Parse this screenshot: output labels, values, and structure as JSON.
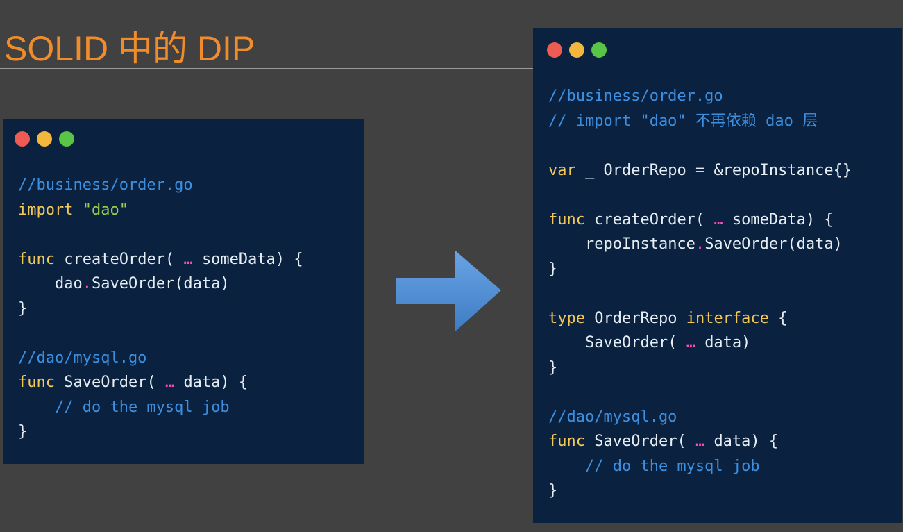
{
  "title": "SOLID 中的 DIP",
  "colors": {
    "background": "#414141",
    "title": "#f08c2c",
    "code_bg": "#0a2240",
    "comment": "#3d8fe0",
    "keyword": "#f4c857",
    "string": "#97cf4a",
    "operator": "#ff4dc0",
    "arrow": "#4a8ad0"
  },
  "left_code": {
    "l1": {
      "comment": "//business/order.go"
    },
    "l2": {
      "kw": "import",
      "str": "\"dao\""
    },
    "l4": {
      "kw": "func",
      "name": "createOrder(",
      "ellipsis": "…",
      "rest": "someData) {"
    },
    "l5": {
      "obj": "dao",
      "dot": ".",
      "call": "SaveOrder(data)"
    },
    "l6": {
      "brace": "}"
    },
    "l8": {
      "comment": "//dao/mysql.go"
    },
    "l9": {
      "kw": "func",
      "name": "SaveOrder(",
      "ellipsis": "…",
      "rest": "data) {"
    },
    "l10": {
      "comment": "// do the mysql job"
    },
    "l11": {
      "brace": "}"
    }
  },
  "right_code": {
    "l1": {
      "comment": "//business/order.go"
    },
    "l2": {
      "comment": "// import \"dao\" 不再依赖 dao 层"
    },
    "l4": {
      "kw": "var",
      "rest": "_ OrderRepo = &repoInstance{}"
    },
    "l6": {
      "kw": "func",
      "name": "createOrder(",
      "ellipsis": "…",
      "rest": "someData) {"
    },
    "l7": {
      "obj": "repoInstance",
      "dot": ".",
      "call": "SaveOrder(data)"
    },
    "l8": {
      "brace": "}"
    },
    "l10": {
      "kw": "type",
      "name": "OrderRepo",
      "kw2": "interface",
      "rest": "{"
    },
    "l11": {
      "name": "SaveOrder(",
      "ellipsis": "…",
      "rest": "data)"
    },
    "l12": {
      "brace": "}"
    },
    "l14": {
      "comment": "//dao/mysql.go"
    },
    "l15": {
      "kw": "func",
      "name": "SaveOrder(",
      "ellipsis": "…",
      "rest": "data) {"
    },
    "l16": {
      "comment": "// do the mysql job"
    },
    "l17": {
      "brace": "}"
    }
  },
  "icons": {
    "window_dots": [
      "close-dot",
      "minimize-dot",
      "maximize-dot"
    ],
    "arrow": "right-arrow-icon"
  }
}
